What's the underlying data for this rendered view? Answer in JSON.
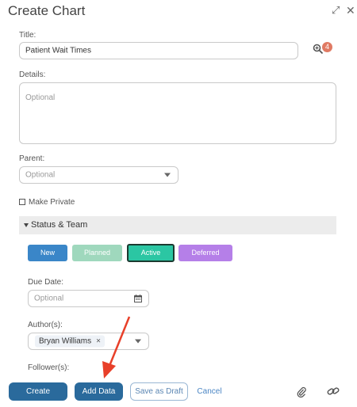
{
  "window": {
    "title": "Create Chart"
  },
  "form": {
    "title_label": "Title:",
    "title_value": "Patient Wait Times",
    "zoom_badge": "4",
    "details_label": "Details:",
    "details_placeholder": "Optional",
    "parent_label": "Parent:",
    "parent_placeholder": "Optional",
    "private_label": "Make Private",
    "section_label": "Status & Team",
    "statuses": [
      "New",
      "Planned",
      "Active",
      "Deferred"
    ],
    "selected_status": "Active",
    "due_label": "Due Date:",
    "due_placeholder": "Optional",
    "authors_label": "Author(s):",
    "author_chip": "Bryan Williams",
    "chip_remove": "×",
    "followers_label": "Follower(s):"
  },
  "footer": {
    "create": "Create",
    "add_data": "Add Data",
    "save_draft": "Save as Draft",
    "cancel": "Cancel"
  },
  "colors": {
    "new": "#3a86c8",
    "planned": "#9fd8bd",
    "active": "#2bc6a3",
    "deferred": "#b57fe8",
    "primary": "#2a6a9c",
    "arrow": "#e8402a"
  }
}
